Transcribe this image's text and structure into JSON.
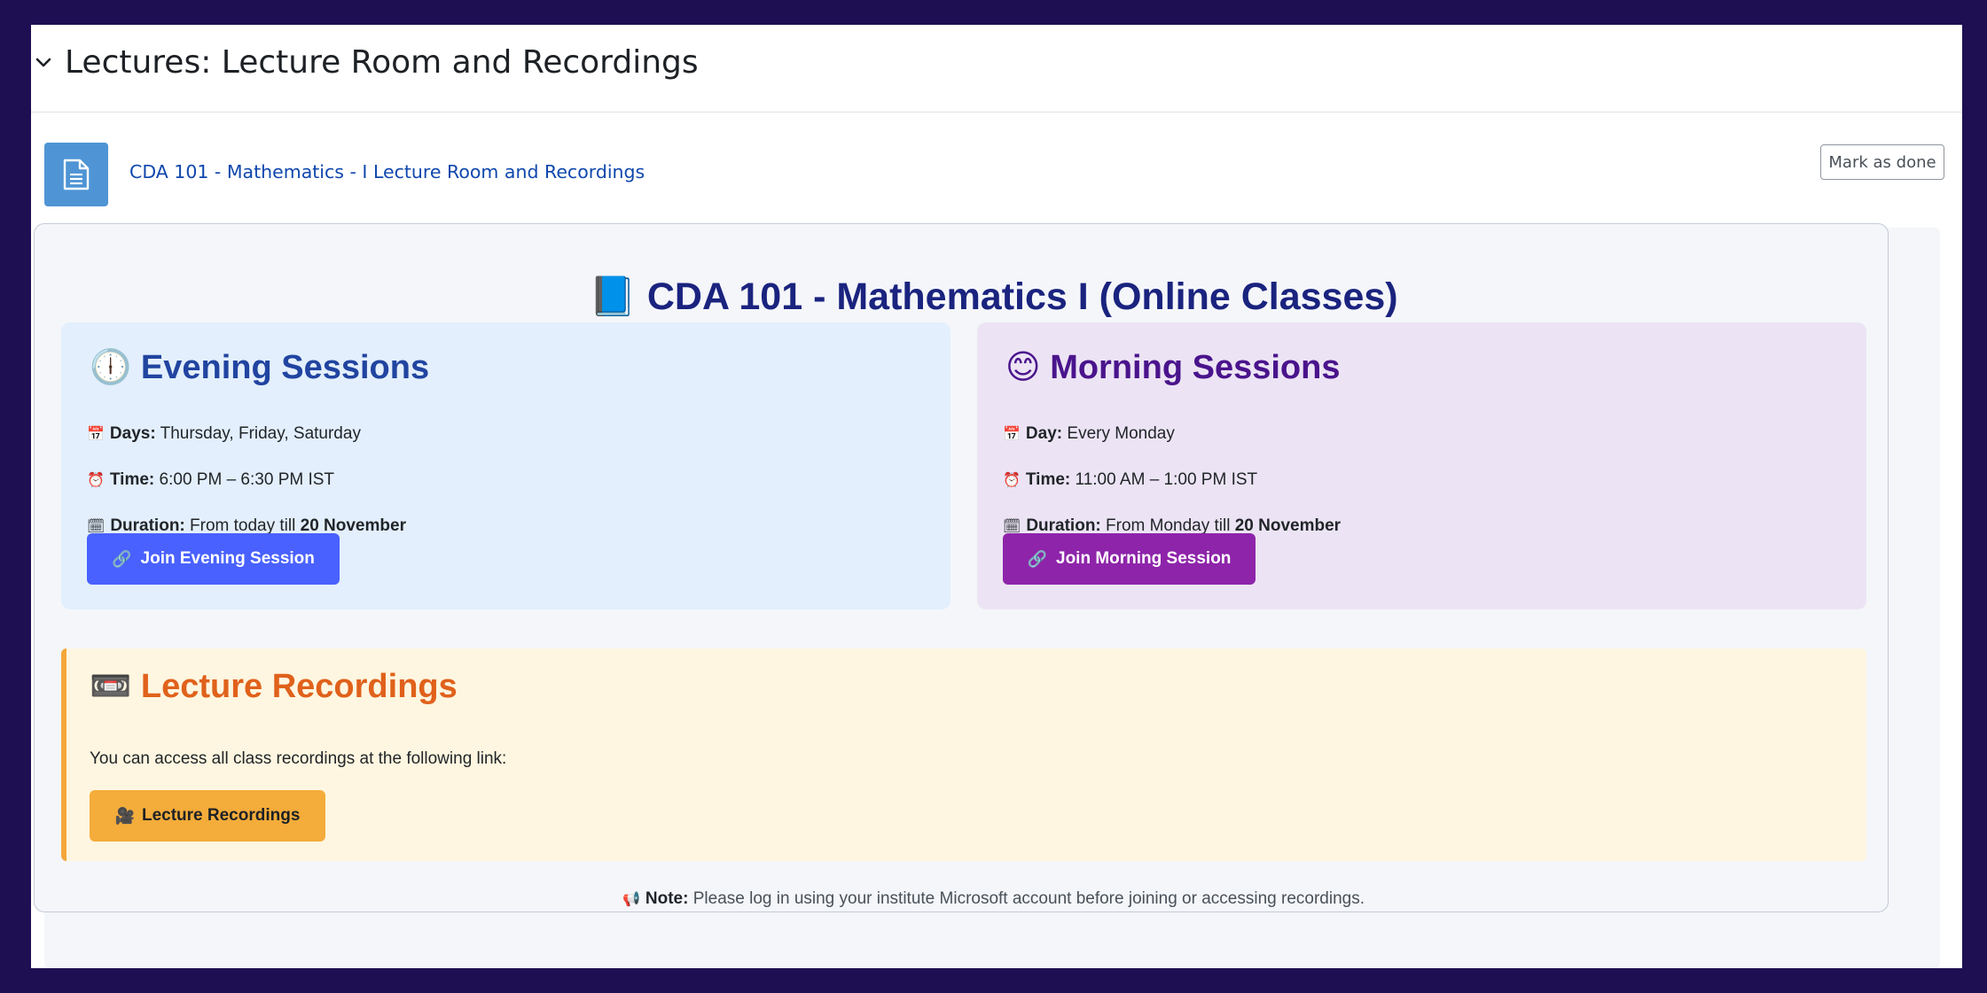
{
  "section": {
    "title": "Lectures: Lecture Room and Recordings"
  },
  "activity": {
    "link_text": "CDA 101 - Mathematics - I Lecture Room and Recordings",
    "icon": "document-icon",
    "mark_done_label": "Mark as done"
  },
  "card": {
    "title_emoji": "📘",
    "title": "CDA 101 - Mathematics I (Online Classes)"
  },
  "evening": {
    "emoji": "🕕",
    "heading": "Evening Sessions",
    "days_emoji": "📅",
    "days_label": "Days:",
    "days_value": "Thursday, Friday, Saturday",
    "time_emoji": "⏰",
    "time_label": "Time:",
    "time_value": "6:00 PM – 6:30 PM IST",
    "duration_emoji": "🗓",
    "duration_label": "Duration:",
    "duration_prefix": "From today till",
    "duration_end": "20 November",
    "button_emoji": "🔗",
    "button_label": "Join Evening Session",
    "color": "#4961ff"
  },
  "morning": {
    "emoji": "😊",
    "heading": "Morning Sessions",
    "day_emoji": "📅",
    "day_label": "Day:",
    "day_value": "Every Monday",
    "time_emoji": "⏰",
    "time_label": "Time:",
    "time_value": "11:00 AM – 1:00 PM IST",
    "duration_emoji": "🗓",
    "duration_label": "Duration:",
    "duration_prefix": "From Monday till",
    "duration_end": "20 November",
    "button_emoji": "🔗",
    "button_label": "Join Morning Session",
    "color": "#8e24aa"
  },
  "recordings": {
    "emoji": "📼",
    "heading": "Lecture Recordings",
    "text": "You can access all class recordings at the following link:",
    "button_emoji": "🎥",
    "button_label": "Lecture Recordings",
    "color": "#f4ac3a"
  },
  "note": {
    "emoji": "📢",
    "label": "Note:",
    "text": "Please log in using your institute Microsoft account before joining or accessing recordings."
  }
}
